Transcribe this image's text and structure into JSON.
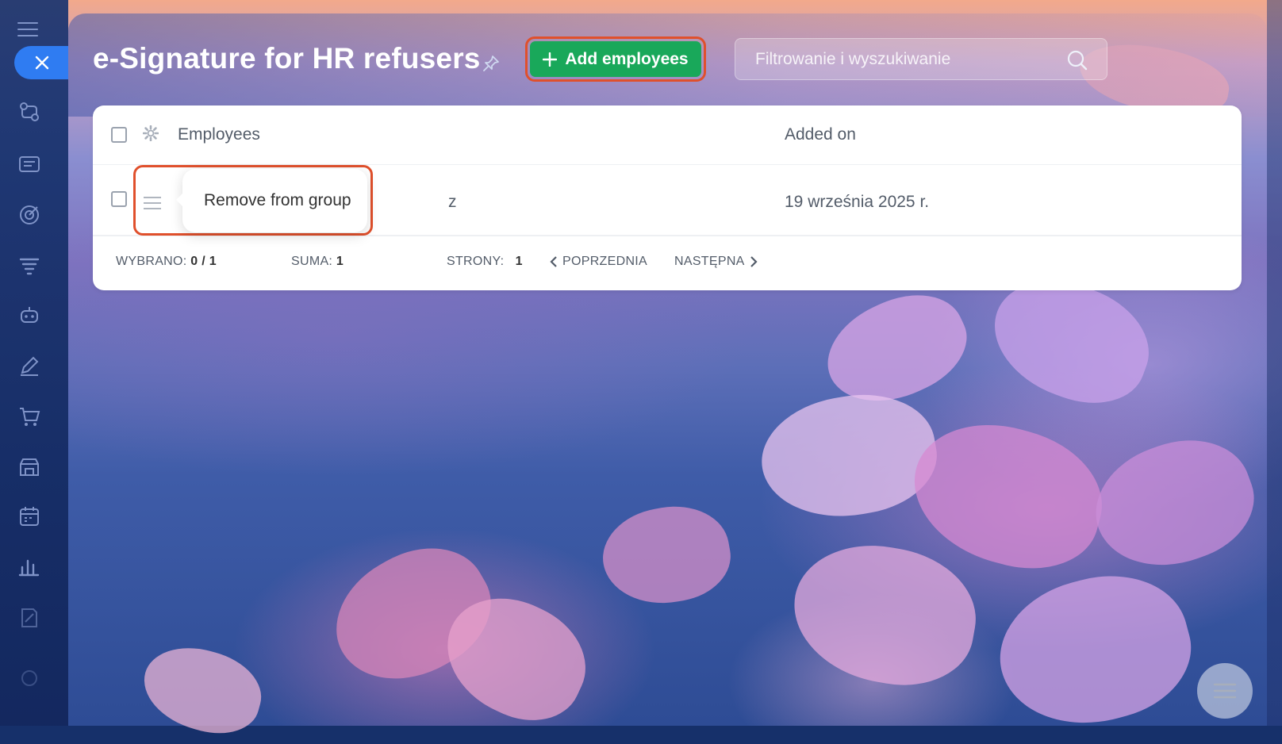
{
  "slider": {
    "title": "e-Signature for HR refusers",
    "add_button_label": "Add employees",
    "search": {
      "placeholder": "Filtrowanie i wyszukiwanie",
      "value": ""
    }
  },
  "grid": {
    "columns": {
      "employees": "Employees",
      "added_on": "Added on"
    },
    "rows": [
      {
        "name_visible_fragment": "z",
        "added_on": "19 września 2025 r."
      }
    ],
    "context_menu": {
      "remove_label": "Remove from group"
    },
    "footer": {
      "selected_label": "WYBRANO:",
      "selected_value": "0 / 1",
      "total_label": "SUMA:",
      "total_value": "1",
      "pages_label": "STRONY:",
      "pages_value": "1",
      "prev_label": "POPRZEDNIA",
      "next_label": "NASTĘPNA"
    }
  },
  "icons": {
    "close": "close-icon",
    "pin": "pin-icon",
    "plus": "plus-icon",
    "search": "search-icon",
    "gear": "gear-icon",
    "drag": "drag-handle-icon",
    "menu": "list-icon"
  },
  "colors": {
    "add_button": "#19a85a",
    "highlight_outline": "#e0502c",
    "close_button": "#2f7cf2"
  }
}
